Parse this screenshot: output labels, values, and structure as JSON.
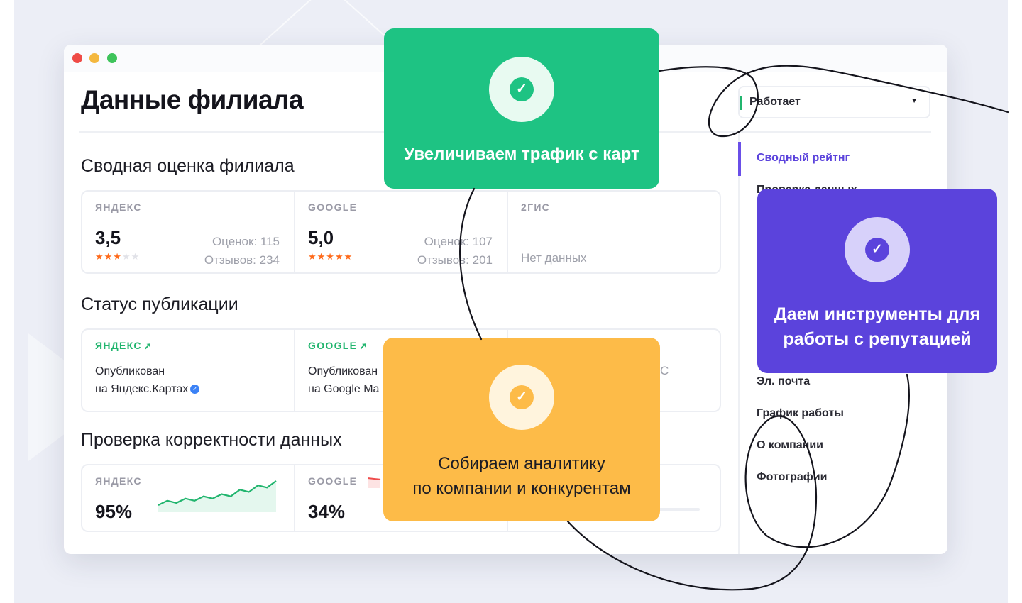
{
  "window": {
    "traffic_lights": [
      "#ef4b46",
      "#f4b83f",
      "#3fc45b"
    ]
  },
  "page_title": "Данные филиала",
  "summary": {
    "title": "Сводная оценка филиала",
    "cards": [
      {
        "source": "ЯНДЕКС",
        "score": "3,5",
        "stars_filled": 3,
        "ratings": "Оценок: 115",
        "reviews": "Отзывов: 234",
        "stars": "★★★",
        "stars_empty": "★★"
      },
      {
        "source": "GOOGLE",
        "score": "5,0",
        "stars_filled": 5,
        "ratings": "Оценок: 107",
        "reviews": "Отзывов: 201",
        "stars": "★★★★★",
        "stars_empty": ""
      },
      {
        "source": "2ГИС",
        "no_data": "Нет данных"
      }
    ]
  },
  "publication": {
    "title": "Статус публикации",
    "arrow": "➚",
    "cards": [
      {
        "source": "ЯНДЕКС",
        "line1": "Опубликован",
        "line2": "на Яндекс.Картах",
        "verified": "✓"
      },
      {
        "source": "GOOGLE",
        "line1": "Опубликован",
        "line2": "на Google Ma"
      },
      {
        "partial": "С"
      }
    ]
  },
  "validation": {
    "title": "Проверка корректности данных",
    "cards": [
      {
        "source": "ЯНДЕКС",
        "percent": "95%",
        "trend": [
          3,
          5,
          4,
          6,
          5,
          7,
          6,
          8,
          7,
          10,
          9,
          12,
          11,
          14
        ]
      },
      {
        "source": "GOOGLE",
        "percent": "34%"
      },
      {}
    ]
  },
  "sidebar": {
    "status": {
      "value": "Работает",
      "chevron": "▼"
    },
    "items": [
      {
        "label": "Сводный рейтнг",
        "active": true
      },
      {
        "label": "Проверка данных"
      },
      {
        "label": "Эл. почта"
      },
      {
        "label": "График работы"
      },
      {
        "label": "О компании"
      },
      {
        "label": "Фотографии"
      }
    ]
  },
  "callouts": {
    "traffic": {
      "text": "Увеличиваем трафик с карт",
      "check": "✓"
    },
    "reputation": {
      "line1": "Даем инструменты для",
      "line2": "работы с репутацией",
      "check": "✓"
    },
    "analytics": {
      "line1": "Собираем аналитику",
      "line2": "по компании и конкурентам",
      "check": "✓"
    }
  },
  "colors": {
    "green": "#1ec383",
    "purple": "#5b43dc",
    "yellow": "#fdbb48",
    "star": "#ff6a1a",
    "published": "#21b56e"
  }
}
